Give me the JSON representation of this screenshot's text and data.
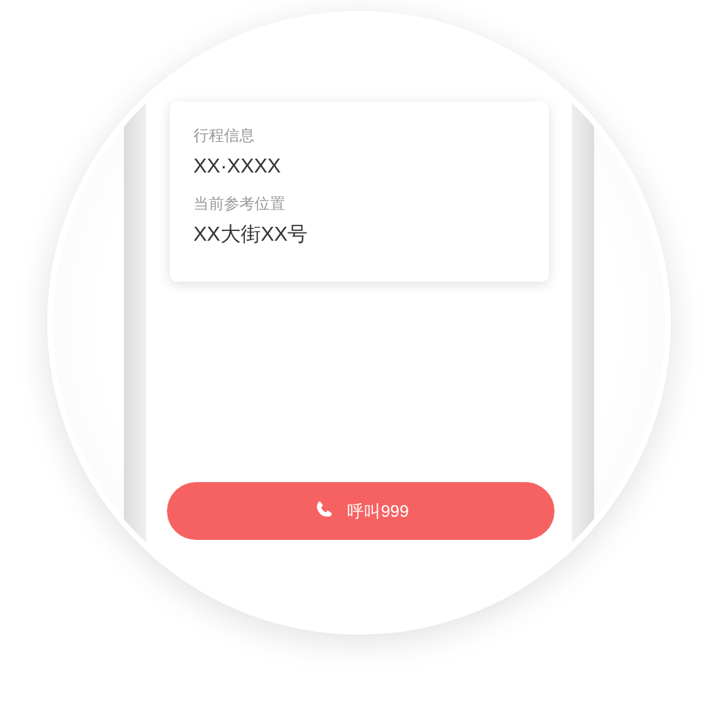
{
  "trip_card": {
    "fields": [
      {
        "label": "行程信息",
        "value": "XX·XXXX"
      },
      {
        "label": "当前参考位置",
        "value": "XX大街XX号"
      }
    ]
  },
  "call_button": {
    "label": "呼叫999"
  }
}
